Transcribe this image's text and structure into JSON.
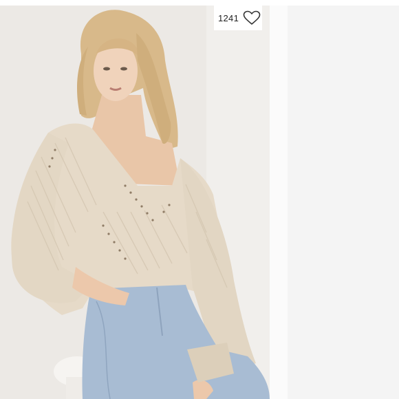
{
  "listing": {
    "like_count": "1241",
    "like_icon": "heart-outline-icon",
    "photo_subject": "product-photo"
  },
  "colors": {
    "background": "#ebe8e4",
    "sweater": "#e7dccb",
    "jeans": "#a9bdd4",
    "heart_stroke": "#333333"
  }
}
